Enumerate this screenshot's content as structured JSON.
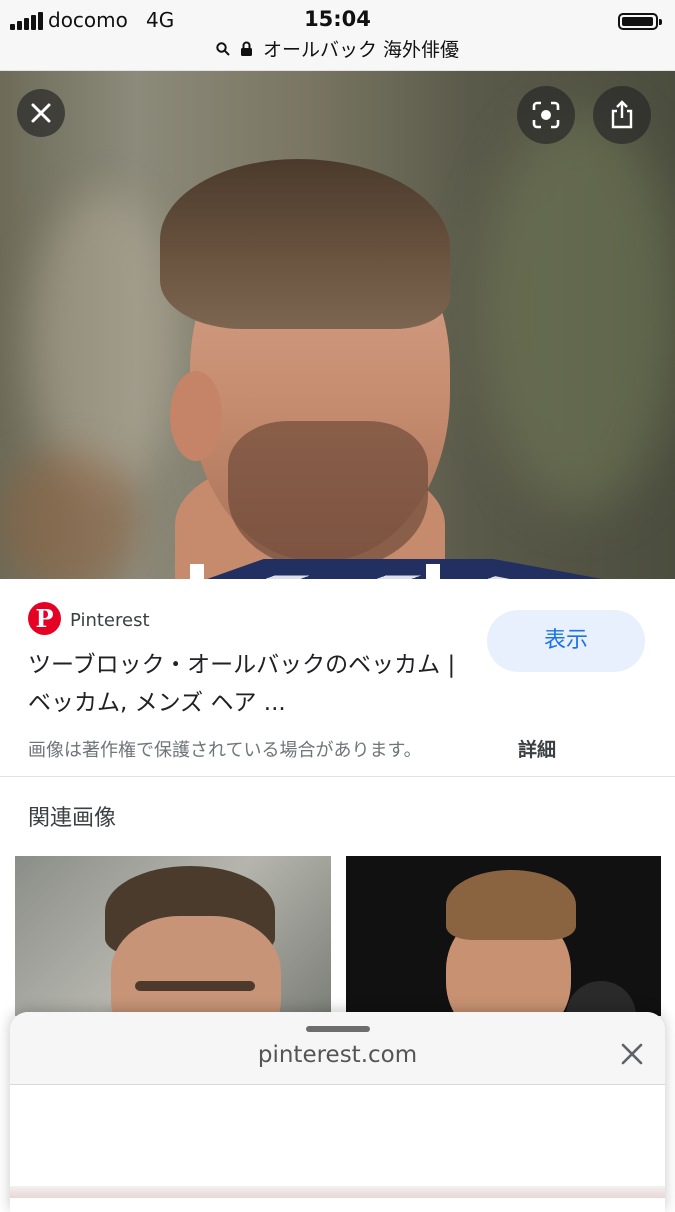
{
  "status_bar": {
    "carrier": "docomo",
    "network": "4G",
    "time": "15:04",
    "url_text": "オールバック 海外俳優"
  },
  "hero": {
    "close_icon": "close-icon",
    "lens_icon": "lens-icon",
    "share_icon": "share-icon"
  },
  "source": {
    "logo_letter": "P",
    "site_name": "Pinterest",
    "title": "ツーブロック・オールバックのベッカム | ベッカム, メンズ ヘア ...",
    "view_button": "表示",
    "copyright": "画像は著作権で保護されている場合があります。",
    "details_link": "詳細",
    "brand_color": "#e60023",
    "accent_color": "#1a73e8"
  },
  "related": {
    "heading": "関連画像"
  },
  "sheet": {
    "domain": "pinterest.com"
  }
}
